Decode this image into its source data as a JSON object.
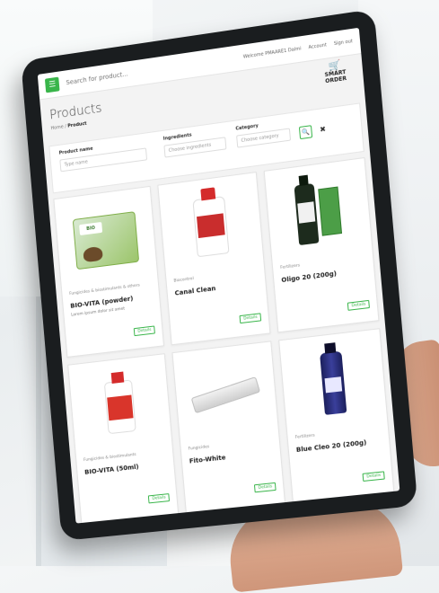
{
  "app": {
    "search_placeholder": "Search for product...",
    "welcome_text": "Welcome PMAARE1 Dalmi",
    "account_link": "Account",
    "signout_link": "Sign out"
  },
  "logo": {
    "line1": "SMART",
    "line2": "ORDER"
  },
  "page": {
    "title": "Products"
  },
  "breadcrumb": {
    "home": "Home",
    "separator": "/",
    "current": "Product"
  },
  "filters": {
    "product_name_label": "Product name",
    "product_name_placeholder": "Type name",
    "ingredients_label": "Ingredients",
    "ingredients_placeholder": "Choose ingredients",
    "category_label": "Category",
    "category_placeholder": "Choose category"
  },
  "products": [
    {
      "category": "Fungicides & biostimulants & others",
      "name": "BIO-VITA (powder)",
      "description": "Lorem ipsum dolor sit amet",
      "button": "Details"
    },
    {
      "category": "Biocontrol",
      "name": "Canal Clean",
      "description": "",
      "button": "Details"
    },
    {
      "category": "Fertilizers",
      "name": "Oligo 20 (200g)",
      "description": "",
      "button": "Details"
    },
    {
      "category": "Fungicides & biostimulants",
      "name": "BIO-VITA (50ml)",
      "description": "",
      "button": "Details"
    },
    {
      "category": "Fungicides",
      "name": "Fito-White",
      "description": "",
      "button": "Details"
    },
    {
      "category": "Fertilizers",
      "name": "Blue Cleo 20 (200g)",
      "description": "",
      "button": "Details"
    }
  ]
}
